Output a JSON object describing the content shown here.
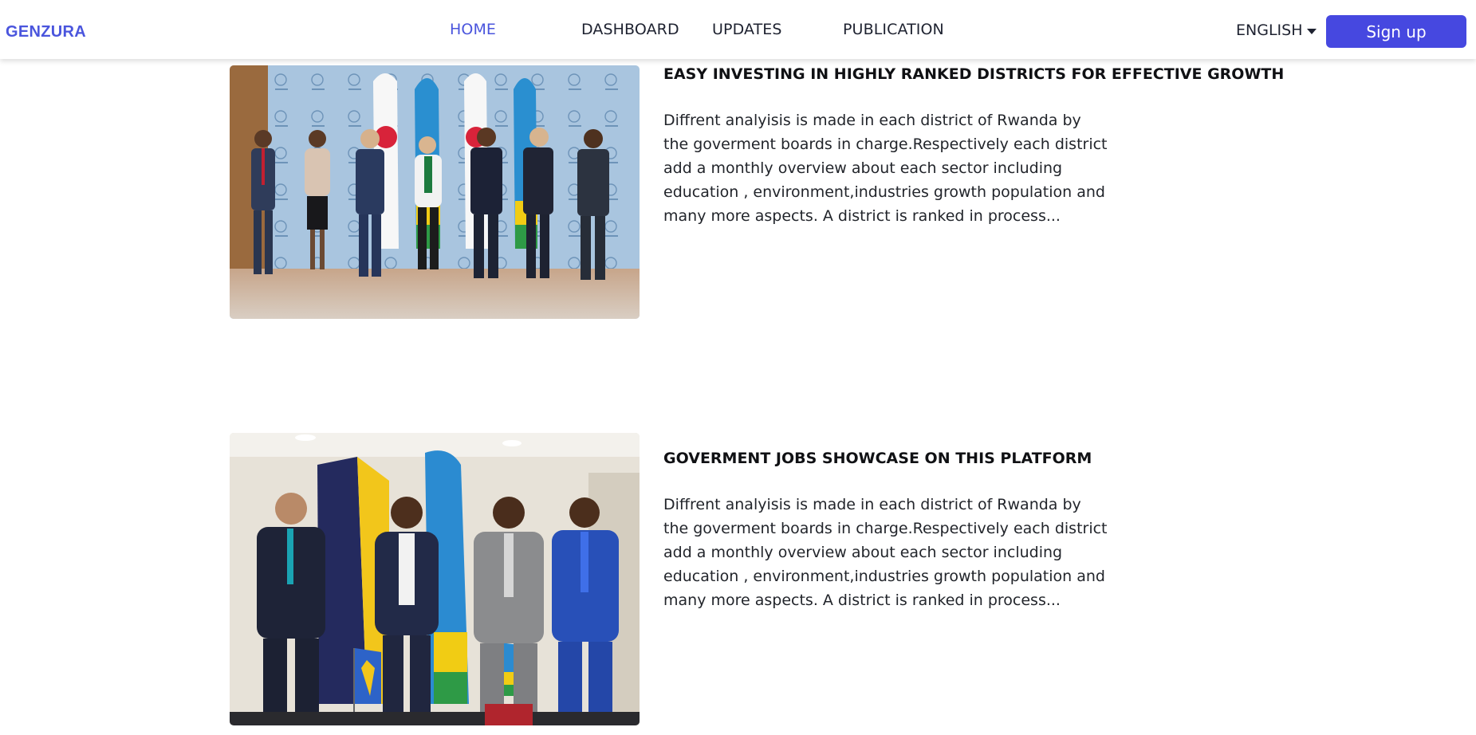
{
  "header": {
    "logo": "GENZURA",
    "nav": [
      {
        "label": "HOME",
        "active": true
      },
      {
        "label": "DASHBOARD",
        "active": false
      },
      {
        "label": "UPDATES",
        "active": false
      },
      {
        "label": "PUBLICATION",
        "active": false
      }
    ],
    "language": "ENGLISH",
    "language_icon": "caret-down-icon",
    "signup_label": "Sign up"
  },
  "articles": [
    {
      "title": "EASY INVESTING IN HIGHLY RANKED DISTRICTS FOR EFFECTIVE GROWTH",
      "excerpt": "Diffrent analyisis is made in each district of Rwanda by the goverment boards in charge.Respectively each district add a monthly overview about each sector including education , environment,industries growth population and many more aspects. A district is ranked in process...",
      "image": "group-photo-rwanda-japan"
    },
    {
      "title": "GOVERMENT JOBS SHOWCASE ON THIS PLATFORM",
      "excerpt": "Diffrent analyisis is made in each district of Rwanda by the goverment boards in charge.Respectively each district add a monthly overview about each sector including education , environment,industries growth population and many more aspects. A district is ranked in process...",
      "image": "group-photo-rwanda-barbados"
    }
  ],
  "colors": {
    "accent": "#4a55dd",
    "button": "#4648e0",
    "text": "#1e2230"
  }
}
